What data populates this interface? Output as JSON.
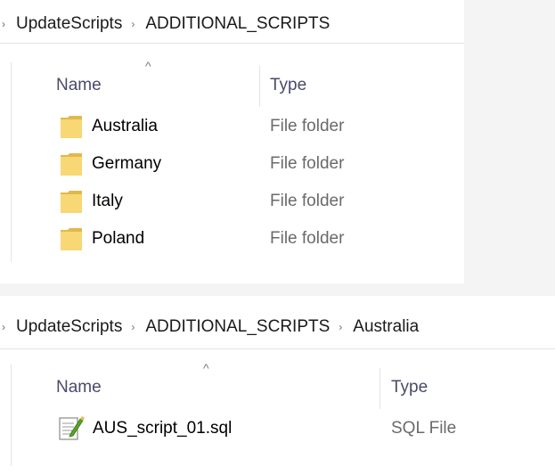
{
  "top_pane": {
    "breadcrumb": [
      "UpdateScripts",
      "ADDITIONAL_SCRIPTS"
    ],
    "columns": {
      "name": "Name",
      "type": "Type"
    },
    "rows": [
      {
        "name": "Australia",
        "type": "File folder",
        "icon": "folder-icon"
      },
      {
        "name": "Germany",
        "type": "File folder",
        "icon": "folder-icon"
      },
      {
        "name": "Italy",
        "type": "File folder",
        "icon": "folder-icon"
      },
      {
        "name": "Poland",
        "type": "File folder",
        "icon": "folder-icon"
      }
    ]
  },
  "bottom_pane": {
    "breadcrumb": [
      "UpdateScripts",
      "ADDITIONAL_SCRIPTS",
      "Australia"
    ],
    "columns": {
      "name": "Name",
      "type": "Type"
    },
    "rows": [
      {
        "name": "AUS_script_01.sql",
        "type": "SQL File",
        "icon": "sql-file-icon"
      }
    ]
  },
  "glyphs": {
    "breadcrumb_separator": "›",
    "sort_indicator": "^"
  },
  "colors": {
    "folder": "#f8d775",
    "folder_dark": "#e0b94a",
    "background": "#f4f4f4",
    "divider": "#e3e3e3",
    "header_text": "#4a4a6a",
    "type_text": "#6a6a6a"
  }
}
